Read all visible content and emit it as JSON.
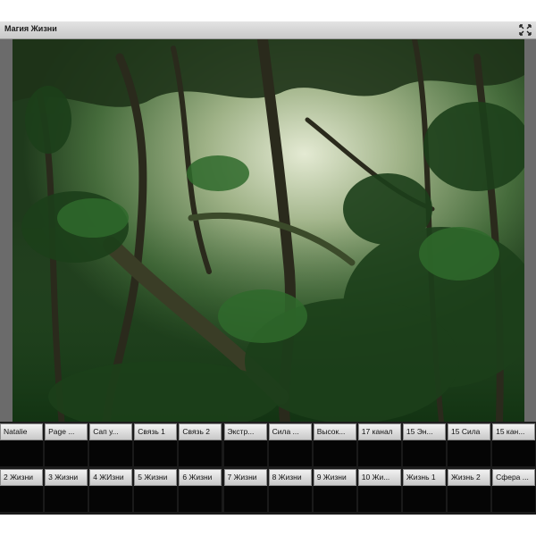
{
  "window": {
    "title": "Магия Жизни",
    "fullscreen_icon": "expand-arrows-icon"
  },
  "grid": {
    "row1": [
      "Natalie",
      "Page ...",
      "Сап у...",
      "Связь 1",
      "Связь 2",
      "Экстр...",
      "Сила ...",
      "Высок...",
      "17 канал",
      "15 Эн...",
      "15 Сила",
      "15 кан..."
    ],
    "row2": [
      "2 Жизни",
      "3 Жизни",
      "4 ЖИзни",
      "5 Жизни",
      "6 Жизни",
      "7 Жизни",
      "8 Жизни",
      "9 Жизни",
      "10 Жи...",
      "Жизнь 1",
      "Жизнь 2",
      "Сфера ..."
    ]
  }
}
